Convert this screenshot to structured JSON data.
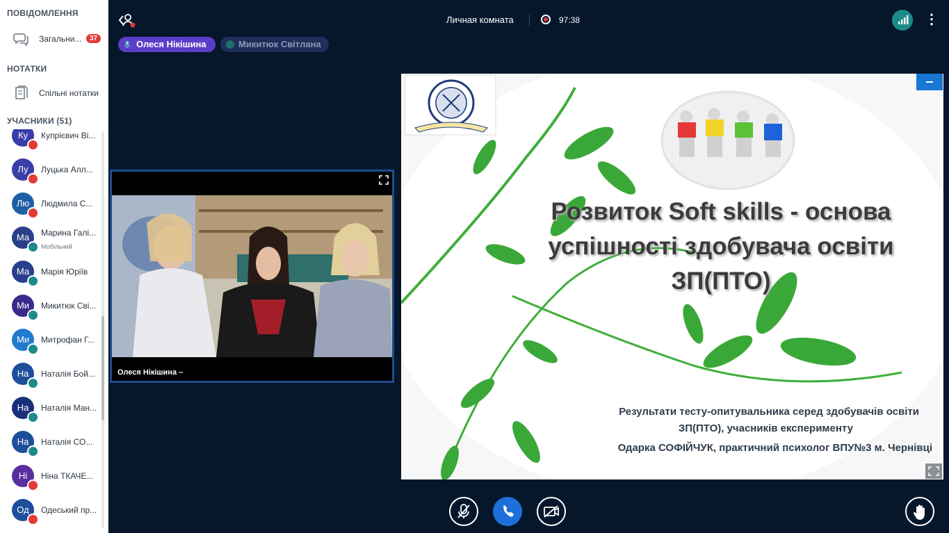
{
  "sidebar": {
    "messages_title": "ПОВІДОМЛЕННЯ",
    "chat_label": "Загальни...",
    "chat_badge": "37",
    "notes_title": "НОТАТКИ",
    "notes_label": "Спільні нотатки",
    "participants_title": "УЧАСНИКИ (51)",
    "participants": [
      {
        "initials": "Ку",
        "name": "Купрієвич Ві...",
        "status": "mic",
        "color": "#3a3ea8"
      },
      {
        "initials": "Лу",
        "name": "Луцька Алл...",
        "status": "mic",
        "color": "#3a3ea8"
      },
      {
        "initials": "Лю",
        "name": "Людмила С...",
        "status": "mic",
        "color": "#1f5fa8"
      },
      {
        "initials": "Ма",
        "name": "Марина Галі...",
        "sub": "Мобільний",
        "status": "head",
        "color": "#2a3f8a"
      },
      {
        "initials": "Ма",
        "name": "Марія Юріїв",
        "status": "head",
        "color": "#2a3f8a"
      },
      {
        "initials": "Ми",
        "name": "Микитюк Сві...",
        "status": "head",
        "color": "#3a2a8a"
      },
      {
        "initials": "Ми",
        "name": "Митрофан Г...",
        "status": "head",
        "color": "#1f7ad0"
      },
      {
        "initials": "На",
        "name": "Наталія Бой...",
        "status": "head",
        "color": "#1f4f9a"
      },
      {
        "initials": "На",
        "name": "Наталія Ман...",
        "status": "head",
        "color": "#1a2f7a"
      },
      {
        "initials": "На",
        "name": "Наталія СО...",
        "status": "head",
        "color": "#1f4f9a"
      },
      {
        "initials": "Ні",
        "name": "Ніна ТКАЧЕ...",
        "status": "mic",
        "color": "#5a2ea0"
      },
      {
        "initials": "Од",
        "name": "Одеський пр...",
        "status": "mic",
        "color": "#1f4f9a"
      }
    ]
  },
  "topbar": {
    "room_title": "Личная комната",
    "timer": "97:38"
  },
  "speakers": [
    {
      "name": "Олеся Нікішина",
      "active": true
    },
    {
      "name": "Микитюк Світлана",
      "active": false
    }
  ],
  "video": {
    "name_label": "Олеся Нікішина –"
  },
  "slide": {
    "title": "Розвиток Soft skills - основа успішності здобувача освіти ЗП(ПТО)",
    "subtitle_line1": "Результати тесту-опитувальника серед здобувачів освіти",
    "subtitle_line2": "ЗП(ПТО), учасників експерименту",
    "author": "Одарка СОФІЙЧУК, практичний психолог ВПУ№3 м. Чернівці"
  },
  "colors": {
    "background": "#06172b",
    "accent": "#1e6fd9",
    "recording": "#e53935",
    "active_speaker": "#5b3ec8"
  },
  "icons": [
    "chat-icon",
    "notes-icon",
    "leave-icon",
    "record-icon",
    "signal-icon",
    "more-icon",
    "expand-icon",
    "mic-off-icon",
    "phone-icon",
    "camera-off-icon",
    "raise-hand-icon"
  ]
}
